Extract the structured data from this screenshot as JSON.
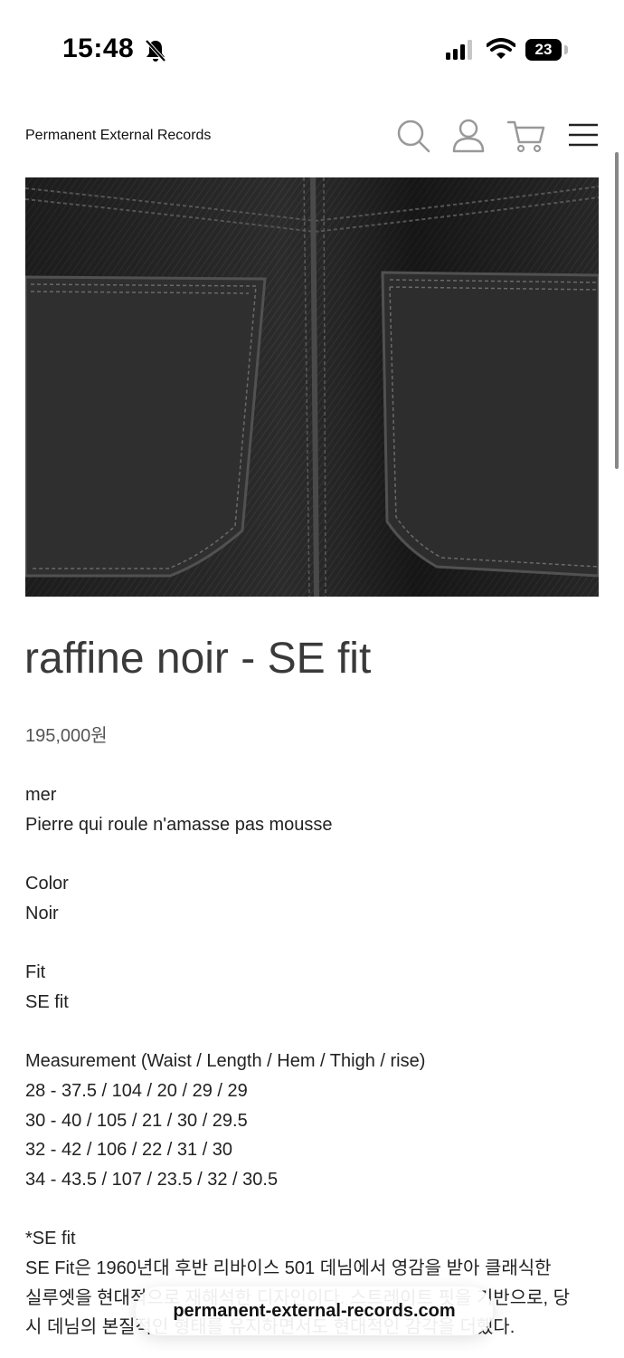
{
  "status_bar": {
    "time": "15:48",
    "battery": "23"
  },
  "header": {
    "site_name": "Permanent External Records"
  },
  "product": {
    "title": "raffine noir - SE fit",
    "price": "195,000원"
  },
  "description": {
    "line_1": "mer",
    "line_2": "Pierre qui roule n'amasse pas mousse",
    "color_label": "Color",
    "color_value": "Noir",
    "fit_label": "Fit",
    "fit_value": "SE fit",
    "measurement_label": "Measurement (Waist / Length / Hem / Thigh / rise)",
    "measurements": [
      "28 - 37.5 / 104 / 20 / 29 / 29",
      "30 - 40 / 105 / 21 / 30 / 29.5",
      "32 - 42 / 106 / 22 / 31 / 30",
      "34 - 43.5 / 107 / 23.5 / 32 / 30.5"
    ],
    "se_fit_heading": "*SE fit",
    "se_fit_text": [
      "SE Fit은 1960년대 후반 리바이스 501 데님에서 영감을 받아 클래식한",
      "실루엣을 현대적으로 재해석한 디자인이다. 스트레이트 핏을 기반으로, 당",
      "시 데님의 본질적인 형태를 유지하면서도 현대적인 감각을 더했다."
    ]
  },
  "browser": {
    "url": "permanent-external-records.com"
  }
}
